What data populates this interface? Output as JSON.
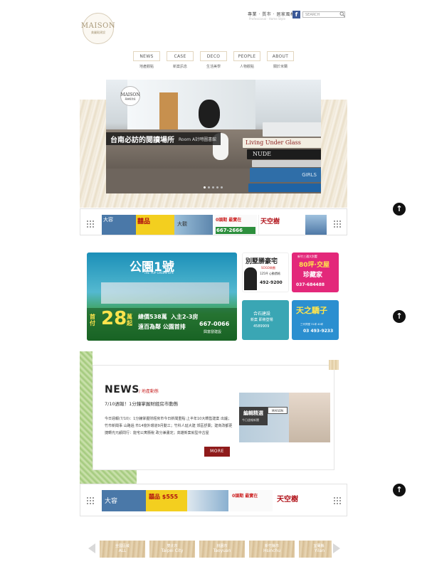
{
  "header": {
    "logo_title": "MAISON",
    "logo_sub": "美麗殿建設",
    "tagline": "專業 · 質市 · 居家風格",
    "subtag": "Professional · Home Style",
    "search_placeholder": "SEARCH",
    "facebook_glyph": "f"
  },
  "nav": [
    {
      "label": "NEWS",
      "sub": "地產觀點"
    },
    {
      "label": "CASE",
      "sub": "新案訊息"
    },
    {
      "label": "DECO",
      "sub": "生活美學"
    },
    {
      "label": "PEOPLE",
      "sub": "人物觀點"
    },
    {
      "label": "ABOUT",
      "sub": "關於米蘭"
    }
  ],
  "hero": {
    "badge_title": "MAISON",
    "badge_sub": "美麗殿建設",
    "caption_title": "台南必訪的閱讀場所",
    "caption_sub": "Room A計時圖書館",
    "books": [
      "",
      "Living Under Glass",
      "NUDE",
      "",
      "GIRLS"
    ]
  },
  "strip1_ads": [
    {
      "text": "大容",
      "color": "#4a78a8"
    },
    {
      "text": "囍品",
      "color": "#f3cf1f"
    },
    {
      "text": "大觀",
      "color": "#7fa9c8"
    },
    {
      "text": "0頭期 最實在",
      "color": "#f7f7f7"
    },
    {
      "text": "667-2666",
      "color": "#2d8f3d"
    },
    {
      "text": "天空樹",
      "color": "#ffffff"
    },
    {
      "text": "",
      "color": "#6a8fb7"
    }
  ],
  "big_ad": {
    "title": "公園1號",
    "subtitle": "THE TOP GREEN LIFE",
    "price_prefix": "首付",
    "price": "28",
    "price_suffix": "萬起",
    "detail1": "總價538萬",
    "detail2": "入主2-3房",
    "detail3": "遠百為鄰 公園首排",
    "phone": "667-0066",
    "builder": "興富發建設"
  },
  "small_ads": [
    {
      "title": "別墅勝豪宅",
      "sub": "SOGO商圈",
      "line2": "125坪 心動價格",
      "phone": "492-9200"
    },
    {
      "title": "80坪·交屋",
      "sub": "新竹三通大別墅",
      "line2": "珍藏家",
      "phone": "037-684488"
    },
    {
      "title": "合石建設",
      "sub": "新案 即將登場",
      "line2": "",
      "phone": "4589909"
    },
    {
      "title": "天之驕子",
      "sub": "三代同堂 31坪 40坪",
      "line2": "",
      "phone": "03 493-9233"
    }
  ],
  "news": {
    "title": "NEWS",
    "tag": "/ 地產動態",
    "headline": "7/10週報！1分鐘掌握財經房市動態",
    "body": "今日週報(7/10)：1分鐘掌握財經房市今日新聞重點:上半年10大轉售建案 出爐；竹市新聞事 山路過 市14億外環道9月動工；竹科人延大建 郊區舒賣；建商改都更 捷轉光元顧問行：能宅公寓衝稅 政分兼畫定；高雄新案就型中古屋",
    "more_label": "MORE",
    "photo_label1": "編輯精選",
    "photo_label2": "今日週報新聞",
    "photo_badge": "MAISON"
  },
  "strip2_ads": [
    {
      "text": "大容",
      "color": "#4a78a8"
    },
    {
      "text": "囍品 $555",
      "color": "#f3cf1f"
    },
    {
      "text": "",
      "color": "#8ab0d0"
    },
    {
      "text": "0頭期 最實在",
      "color": "#f7f7f7"
    },
    {
      "text": "天空樹",
      "color": "#ffffff"
    }
  ],
  "regions": [
    {
      "zh": "全國區域",
      "en": "ALL"
    },
    {
      "zh": "雙北市",
      "en": "Taipei City"
    },
    {
      "zh": "桃園市",
      "en": "Taoyuan"
    },
    {
      "zh": "新竹縣市",
      "en": "Hsinchu"
    },
    {
      "zh": "宜蘭縣",
      "en": "Yilan"
    }
  ],
  "back_to_top_glyph": "↑"
}
